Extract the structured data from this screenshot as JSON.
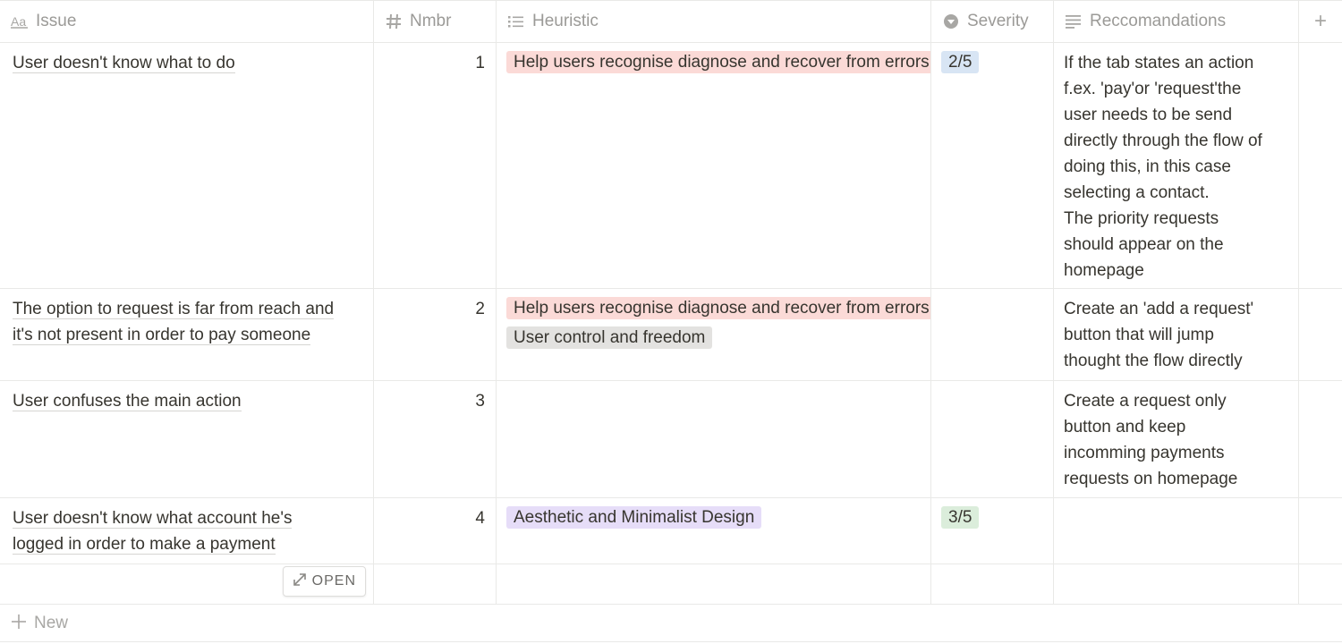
{
  "columns": {
    "issue": {
      "label": "Issue",
      "icon": "text-property-icon"
    },
    "nmbr": {
      "label": "Nmbr",
      "icon": "number-property-icon"
    },
    "heuristic": {
      "label": "Heuristic",
      "icon": "multi-select-property-icon"
    },
    "severity": {
      "label": "Severity",
      "icon": "select-property-icon"
    },
    "recommendations": {
      "label": "Reccomandations",
      "icon": "text-block-property-icon"
    },
    "add": {
      "label": "+",
      "icon": "plus-icon"
    }
  },
  "tag_colors": {
    "red": "#fbdad7",
    "gray": "#e3e2e0",
    "purple": "#e6ddf8",
    "blue": "#d8e5f4",
    "green": "#dbeddb"
  },
  "rows": [
    {
      "issue": "User doesn't know what to do",
      "nmbr": "1",
      "heuristics": [
        "Help users recognise diagnose and recover from errors"
      ],
      "severity": "2/5",
      "recommendation": "If the tab states an action\nf.ex. 'pay'or 'request'the\nuser needs to be send\ndirectly through the flow of\ndoing this, in this case\nselecting a contact.\nThe priority requests\nshould appear on the\nhomepage"
    },
    {
      "issue": "The option to request is far from reach and it's not present in order to pay someone",
      "nmbr": "2",
      "heuristics": [
        "Help users recognise diagnose and recover from errors",
        "User control and freedom"
      ],
      "severity": "",
      "recommendation": "Create an 'add a request'\nbutton that will jump\nthought the flow directly"
    },
    {
      "issue": "User confuses the main action",
      "nmbr": "3",
      "heuristics": [],
      "severity": "",
      "recommendation": "Create a request only\nbutton and keep\nincomming payments\nrequests on homepage"
    },
    {
      "issue": "User doesn't know what account he's logged in order to make a payment",
      "nmbr": "4",
      "heuristics": [
        "Aesthetic and Minimalist Design"
      ],
      "severity": "3/5",
      "recommendation": ""
    }
  ],
  "open_button": {
    "label": "OPEN",
    "icon": "expand-icon"
  },
  "new_row": {
    "label": "New",
    "icon": "plus-icon"
  }
}
